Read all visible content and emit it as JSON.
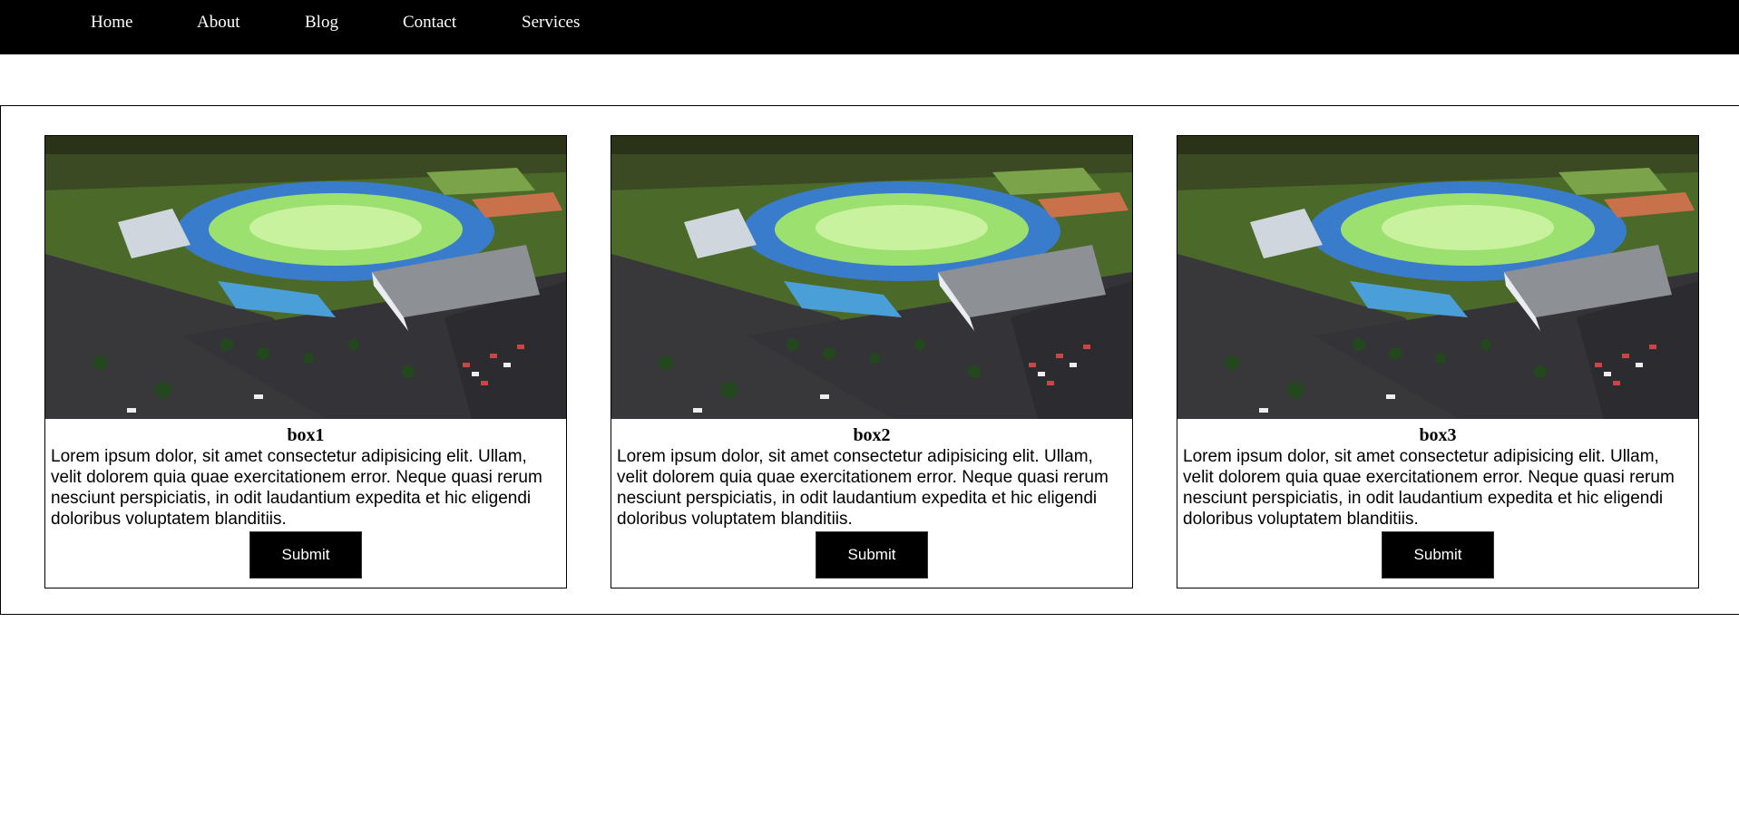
{
  "nav": {
    "items": [
      {
        "label": "Home"
      },
      {
        "label": "About"
      },
      {
        "label": "Blog"
      },
      {
        "label": "Contact"
      },
      {
        "label": "Services"
      }
    ]
  },
  "cards": [
    {
      "title": "box1",
      "text": "Lorem ipsum dolor, sit amet consectetur adipisicing elit. Ullam, velit dolorem quia quae exercitationem error. Neque quasi rerum nesciunt perspiciatis, in odit laudantium expedita et hic eligendi doloribus voluptatem blanditiis.",
      "button_label": "Submit"
    },
    {
      "title": "box2",
      "text": "Lorem ipsum dolor, sit amet consectetur adipisicing elit. Ullam, velit dolorem quia quae exercitationem error. Neque quasi rerum nesciunt perspiciatis, in odit laudantium expedita et hic eligendi doloribus voluptatem blanditiis.",
      "button_label": "Submit"
    },
    {
      "title": "box3",
      "text": "Lorem ipsum dolor, sit amet consectetur adipisicing elit. Ullam, velit dolorem quia quae exercitationem error. Neque quasi rerum nesciunt perspiciatis, in odit laudantium expedita et hic eligendi doloribus voluptatem blanditiis.",
      "button_label": "Submit"
    }
  ],
  "colors": {
    "nav_background": "#000000",
    "nav_text": "#ffffff",
    "button_background": "#000000",
    "button_text": "#ffffff"
  },
  "image": {
    "icon": "stadium-aerial-photo"
  }
}
